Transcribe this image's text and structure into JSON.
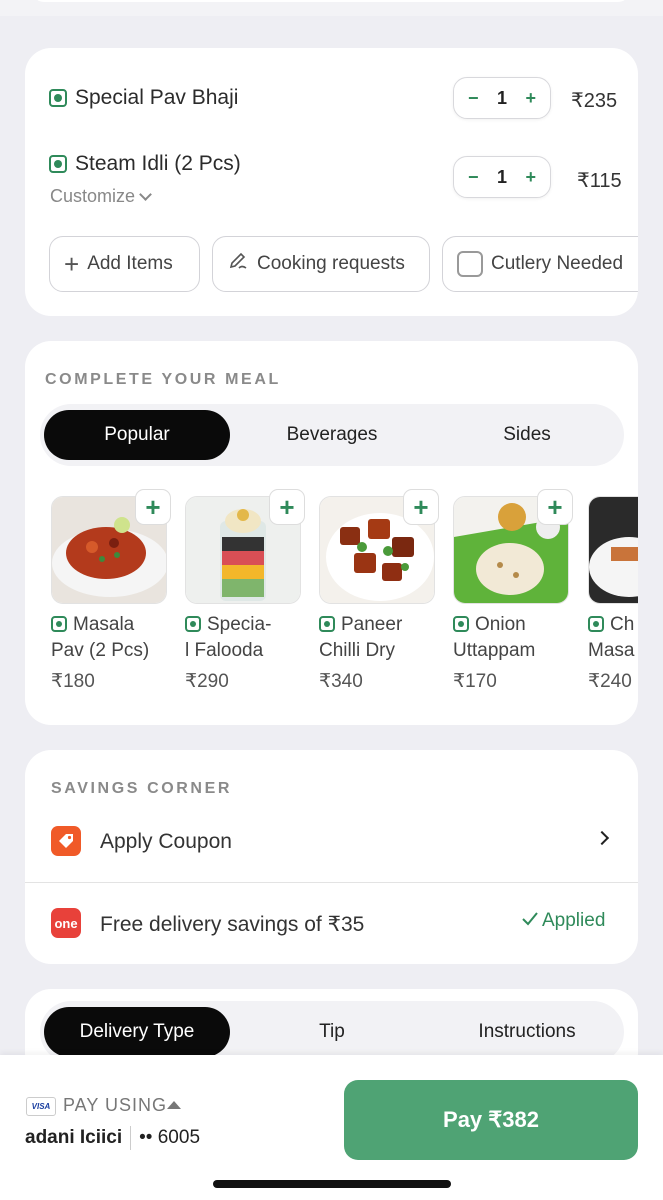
{
  "cart": {
    "items": [
      {
        "name": "Special Pav Bhaji",
        "qty": "1",
        "price": "₹235",
        "sub": ""
      },
      {
        "name": "Steam Idli (2 Pcs)",
        "qty": "1",
        "price": "₹115",
        "sub": "Customize"
      }
    ],
    "actions": {
      "add_items": "Add Items",
      "cooking_requests": "Cooking requests",
      "cutlery": "Cutlery Needed"
    }
  },
  "meal": {
    "title": "COMPLETE YOUR MEAL",
    "tabs": [
      "Popular",
      "Beverages",
      "Sides"
    ],
    "active_tab": "Popular",
    "products": [
      {
        "line1": "Masala",
        "line2": "Pav (2 Pcs)",
        "price": "₹180"
      },
      {
        "line1": "Specia-",
        "line2": "l Falooda",
        "price": "₹290"
      },
      {
        "line1": "Paneer",
        "line2": "Chilli Dry",
        "price": "₹340"
      },
      {
        "line1": "Onion",
        "line2": "Uttappam",
        "price": "₹170"
      },
      {
        "line1": "Ch",
        "line2": "Masa",
        "price": "₹240"
      }
    ]
  },
  "savings": {
    "title": "SAVINGS CORNER",
    "coupon": "Apply Coupon",
    "free_delivery": "Free delivery savings of ₹35",
    "one_badge": "one",
    "applied": "Applied"
  },
  "delivery": {
    "tabs": [
      "Delivery Type",
      "Tip",
      "Instructions"
    ]
  },
  "payment": {
    "card_brand": "VISA",
    "label": "PAY USING",
    "bank": "adani Iciici",
    "masked": "•• 6005",
    "pay_button": "Pay ₹382"
  },
  "colors": {
    "accent_green": "#2F8A5A",
    "pay_green": "#4FA374",
    "coupon_orange": "#F05A28",
    "one_red": "#E8413A"
  }
}
